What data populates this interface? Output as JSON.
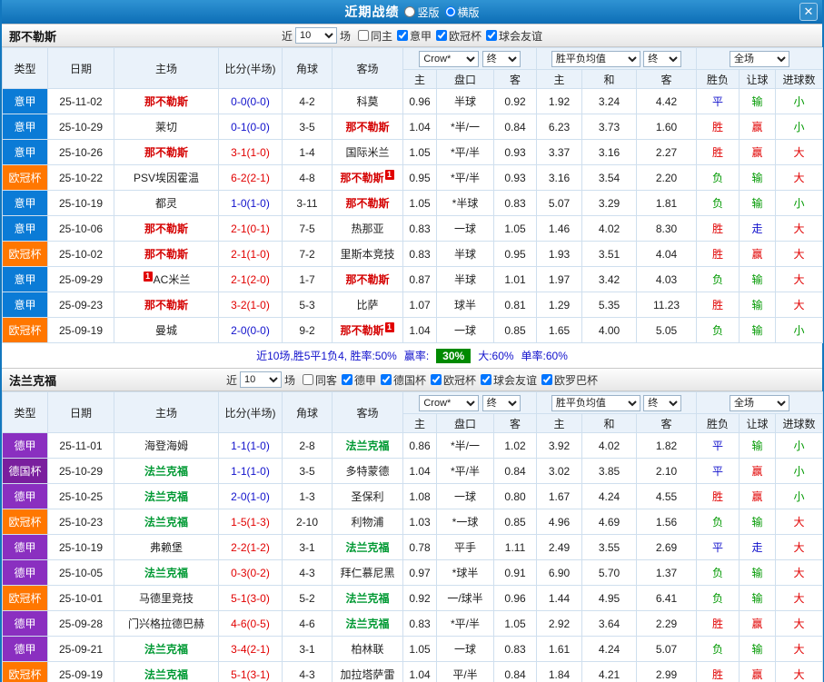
{
  "header": {
    "title": "近期战绩",
    "layout_options": [
      {
        "label": "竖版",
        "selected": false
      },
      {
        "label": "横版",
        "selected": true
      }
    ],
    "close_icon": "✕"
  },
  "filters_common": {
    "near_label": "近",
    "count": "10",
    "games_label": "场"
  },
  "table_header": {
    "type": "类型",
    "date": "日期",
    "home": "主场",
    "score": "比分(半场)",
    "corners": "角球",
    "away": "客场",
    "odds_company": "Crow*",
    "final1": "终",
    "euro_avg": "胜平负均值",
    "final2": "终",
    "scope": "全场",
    "asian_home": "主",
    "handicap": "盘口",
    "asian_away": "客",
    "euro_home": "主",
    "euro_draw": "和",
    "euro_away": "客",
    "result": "胜负",
    "handicap_result": "让球",
    "goals": "进球数"
  },
  "type_colors": {
    "意甲": "#0b7bd6",
    "欧冠杯": "#ff7700",
    "德甲": "#8a2fc0",
    "德国杯": "#7a1f9e"
  },
  "status_colors": {
    "胜": "#e10000",
    "赢": "#e10000",
    "大": "#e10000",
    "负": "#009900",
    "输": "#009900",
    "小": "#009900",
    "平": "#1111cc",
    "走": "#1111cc"
  },
  "score_colors": {
    "over": "#e10000",
    "under": "#1111cc"
  },
  "teams": [
    {
      "name": "那不勒斯",
      "focus_color": "#d40000",
      "filters": [
        {
          "label": "同主",
          "checked": false
        },
        {
          "label": "意甲",
          "checked": true
        },
        {
          "label": "欧冠杯",
          "checked": true
        },
        {
          "label": "球会友谊",
          "checked": true
        }
      ],
      "rows": [
        {
          "type": "意甲",
          "date": "25-11-02",
          "home": "那不勒斯",
          "score": "0-0(0-0)",
          "corners": "4-2",
          "away": "科莫",
          "asian": [
            "0.96",
            "半球",
            "0.92"
          ],
          "euro": [
            "1.92",
            "3.24",
            "4.42"
          ],
          "result": "平",
          "handicap_result": "输",
          "goals": "小"
        },
        {
          "type": "意甲",
          "date": "25-10-29",
          "home": "莱切",
          "score": "0-1(0-0)",
          "corners": "3-5",
          "away": "那不勒斯",
          "asian": [
            "1.04",
            "*半/一",
            "0.84"
          ],
          "euro": [
            "6.23",
            "3.73",
            "1.60"
          ],
          "result": "胜",
          "handicap_result": "赢",
          "goals": "小"
        },
        {
          "type": "意甲",
          "date": "25-10-26",
          "home": "那不勒斯",
          "score": "3-1(1-0)",
          "corners": "1-4",
          "away": "国际米兰",
          "asian": [
            "1.05",
            "*平/半",
            "0.93"
          ],
          "euro": [
            "3.37",
            "3.16",
            "2.27"
          ],
          "result": "胜",
          "handicap_result": "赢",
          "goals": "大"
        },
        {
          "type": "欧冠杯",
          "date": "25-10-22",
          "home": "PSV埃因霍温",
          "score": "6-2(2-1)",
          "corners": "4-8",
          "away": "那不勒斯",
          "away_badge": "1",
          "asian": [
            "0.95",
            "*平/半",
            "0.93"
          ],
          "euro": [
            "3.16",
            "3.54",
            "2.20"
          ],
          "result": "负",
          "handicap_result": "输",
          "goals": "大"
        },
        {
          "type": "意甲",
          "date": "25-10-19",
          "home": "都灵",
          "score": "1-0(1-0)",
          "corners": "3-11",
          "away": "那不勒斯",
          "asian": [
            "1.05",
            "*半球",
            "0.83"
          ],
          "euro": [
            "5.07",
            "3.29",
            "1.81"
          ],
          "result": "负",
          "handicap_result": "输",
          "goals": "小"
        },
        {
          "type": "意甲",
          "date": "25-10-06",
          "home": "那不勒斯",
          "score": "2-1(0-1)",
          "corners": "7-5",
          "away": "热那亚",
          "asian": [
            "0.83",
            "一球",
            "1.05"
          ],
          "euro": [
            "1.46",
            "4.02",
            "8.30"
          ],
          "result": "胜",
          "handicap_result": "走",
          "goals": "大"
        },
        {
          "type": "欧冠杯",
          "date": "25-10-02",
          "home": "那不勒斯",
          "score": "2-1(1-0)",
          "corners": "7-2",
          "away": "里斯本竞技",
          "asian": [
            "0.83",
            "半球",
            "0.95"
          ],
          "euro": [
            "1.93",
            "3.51",
            "4.04"
          ],
          "result": "胜",
          "handicap_result": "赢",
          "goals": "大"
        },
        {
          "type": "意甲",
          "date": "25-09-29",
          "home": "AC米兰",
          "home_badge": "1",
          "score": "2-1(2-0)",
          "corners": "1-7",
          "away": "那不勒斯",
          "asian": [
            "0.87",
            "半球",
            "1.01"
          ],
          "euro": [
            "1.97",
            "3.42",
            "4.03"
          ],
          "result": "负",
          "handicap_result": "输",
          "goals": "大"
        },
        {
          "type": "意甲",
          "date": "25-09-23",
          "home": "那不勒斯",
          "score": "3-2(1-0)",
          "corners": "5-3",
          "away": "比萨",
          "asian": [
            "1.07",
            "球半",
            "0.81"
          ],
          "euro": [
            "1.29",
            "5.35",
            "11.23"
          ],
          "result": "胜",
          "handicap_result": "输",
          "goals": "大"
        },
        {
          "type": "欧冠杯",
          "date": "25-09-19",
          "home": "曼城",
          "score": "2-0(0-0)",
          "corners": "9-2",
          "away": "那不勒斯",
          "away_badge": "1",
          "asian": [
            "1.04",
            "一球",
            "0.85"
          ],
          "euro": [
            "1.65",
            "4.00",
            "5.05"
          ],
          "result": "负",
          "handicap_result": "输",
          "goals": "小"
        }
      ],
      "summary": {
        "text": "近10场,胜5平1负4, 胜率:50%",
        "win_rate_label": "赢率:",
        "win_rate_value": "30%",
        "big_label": "大:60%",
        "single_label": "单率:60%"
      }
    },
    {
      "name": "法兰克福",
      "focus_color": "#009933",
      "filters": [
        {
          "label": "同客",
          "checked": false
        },
        {
          "label": "德甲",
          "checked": true
        },
        {
          "label": "德国杯",
          "checked": true
        },
        {
          "label": "欧冠杯",
          "checked": true
        },
        {
          "label": "球会友谊",
          "checked": true
        },
        {
          "label": "欧罗巴杯",
          "checked": true
        }
      ],
      "rows": [
        {
          "type": "德甲",
          "date": "25-11-01",
          "home": "海登海姆",
          "score": "1-1(1-0)",
          "corners": "2-8",
          "away": "法兰克福",
          "asian": [
            "0.86",
            "*半/一",
            "1.02"
          ],
          "euro": [
            "3.92",
            "4.02",
            "1.82"
          ],
          "result": "平",
          "handicap_result": "输",
          "goals": "小"
        },
        {
          "type": "德国杯",
          "date": "25-10-29",
          "home": "法兰克福",
          "score": "1-1(1-0)",
          "corners": "3-5",
          "away": "多特蒙德",
          "asian": [
            "1.04",
            "*平/半",
            "0.84"
          ],
          "euro": [
            "3.02",
            "3.85",
            "2.10"
          ],
          "result": "平",
          "handicap_result": "赢",
          "goals": "小"
        },
        {
          "type": "德甲",
          "date": "25-10-25",
          "home": "法兰克福",
          "score": "2-0(1-0)",
          "corners": "1-3",
          "away": "圣保利",
          "asian": [
            "1.08",
            "一球",
            "0.80"
          ],
          "euro": [
            "1.67",
            "4.24",
            "4.55"
          ],
          "result": "胜",
          "handicap_result": "赢",
          "goals": "小"
        },
        {
          "type": "欧冠杯",
          "date": "25-10-23",
          "home": "法兰克福",
          "score": "1-5(1-3)",
          "corners": "2-10",
          "away": "利物浦",
          "asian": [
            "1.03",
            "*一球",
            "0.85"
          ],
          "euro": [
            "4.96",
            "4.69",
            "1.56"
          ],
          "result": "负",
          "handicap_result": "输",
          "goals": "大"
        },
        {
          "type": "德甲",
          "date": "25-10-19",
          "home": "弗赖堡",
          "score": "2-2(1-2)",
          "corners": "3-1",
          "away": "法兰克福",
          "asian": [
            "0.78",
            "平手",
            "1.11"
          ],
          "euro": [
            "2.49",
            "3.55",
            "2.69"
          ],
          "result": "平",
          "handicap_result": "走",
          "goals": "大"
        },
        {
          "type": "德甲",
          "date": "25-10-05",
          "home": "法兰克福",
          "score": "0-3(0-2)",
          "corners": "4-3",
          "away": "拜仁慕尼黑",
          "asian": [
            "0.97",
            "*球半",
            "0.91"
          ],
          "euro": [
            "6.90",
            "5.70",
            "1.37"
          ],
          "result": "负",
          "handicap_result": "输",
          "goals": "大"
        },
        {
          "type": "欧冠杯",
          "date": "25-10-01",
          "home": "马德里竞技",
          "score": "5-1(3-0)",
          "corners": "5-2",
          "away": "法兰克福",
          "asian": [
            "0.92",
            "一/球半",
            "0.96"
          ],
          "euro": [
            "1.44",
            "4.95",
            "6.41"
          ],
          "result": "负",
          "handicap_result": "输",
          "goals": "大"
        },
        {
          "type": "德甲",
          "date": "25-09-28",
          "home": "门兴格拉德巴赫",
          "score": "4-6(0-5)",
          "corners": "4-6",
          "away": "法兰克福",
          "asian": [
            "0.83",
            "*平/半",
            "1.05"
          ],
          "euro": [
            "2.92",
            "3.64",
            "2.29"
          ],
          "result": "胜",
          "handicap_result": "赢",
          "goals": "大"
        },
        {
          "type": "德甲",
          "date": "25-09-21",
          "home": "法兰克福",
          "score": "3-4(2-1)",
          "corners": "3-1",
          "away": "柏林联",
          "asian": [
            "1.05",
            "一球",
            "0.83"
          ],
          "euro": [
            "1.61",
            "4.24",
            "5.07"
          ],
          "result": "负",
          "handicap_result": "输",
          "goals": "大"
        },
        {
          "type": "欧冠杯",
          "date": "25-09-19",
          "home": "法兰克福",
          "score": "5-1(3-1)",
          "corners": "4-3",
          "away": "加拉塔萨雷",
          "asian": [
            "1.04",
            "平/半",
            "0.84"
          ],
          "euro": [
            "1.84",
            "4.21",
            "2.99"
          ],
          "result": "胜",
          "handicap_result": "赢",
          "goals": "大"
        }
      ],
      "summary": null
    }
  ]
}
